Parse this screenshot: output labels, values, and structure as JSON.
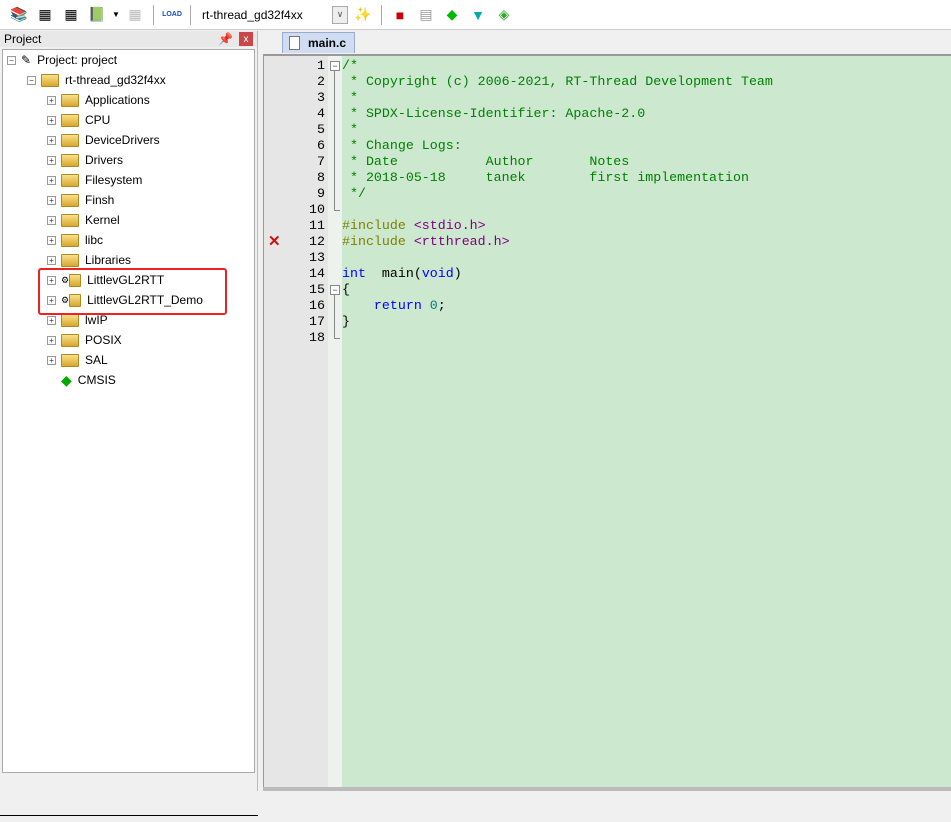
{
  "toolbar": {
    "icons": [
      "translate-icon",
      "build-icon",
      "rebuild-icon",
      "batch-build-icon",
      "stop-build-icon",
      "load-icon"
    ],
    "target": "rt-thread_gd32f4xx",
    "right_icons": [
      "options-icon",
      "manage-components-icon",
      "file-extensions-icon",
      "pack-installer-icon",
      "select-packs-icon",
      "manage-rte-icon"
    ]
  },
  "project": {
    "title": "Project",
    "pin": "⎕",
    "close": "x",
    "root": "Project: project",
    "target": "rt-thread_gd32f4xx",
    "groups": [
      "Applications",
      "CPU",
      "DeviceDrivers",
      "Drivers",
      "Filesystem",
      "Finsh",
      "Kernel",
      "libc",
      "Libraries",
      "LittlevGL2RTT",
      "LittlevGL2RTT_Demo",
      "lwIP",
      "POSIX",
      "SAL"
    ],
    "component": "CMSIS"
  },
  "editor": {
    "tab": "main.c",
    "error_line": 12,
    "lines": [
      [
        [
          "cm",
          "/*"
        ]
      ],
      [
        [
          "cm",
          " * Copyright (c) 2006-2021, RT-Thread Development Team"
        ]
      ],
      [
        [
          "cm",
          " *"
        ]
      ],
      [
        [
          "cm",
          " * SPDX-License-Identifier: Apache-2.0"
        ]
      ],
      [
        [
          "cm",
          " *"
        ]
      ],
      [
        [
          "cm",
          " * Change Logs:"
        ]
      ],
      [
        [
          "cm",
          " * Date           Author       Notes"
        ]
      ],
      [
        [
          "cm",
          " * 2018-05-18     tanek        first implementation"
        ]
      ],
      [
        [
          "cm",
          " */"
        ]
      ],
      [],
      [
        [
          "pp",
          "#include "
        ],
        [
          "str",
          "<stdio.h>"
        ]
      ],
      [
        [
          "pp",
          "#include "
        ],
        [
          "str",
          "<rtthread.h>"
        ]
      ],
      [],
      [
        [
          "kw",
          "int"
        ],
        [
          "",
          "  main("
        ],
        [
          "kw",
          "void"
        ],
        [
          "",
          ")"
        ]
      ],
      [
        [
          "",
          "{"
        ]
      ],
      [
        [
          "",
          "    "
        ],
        [
          "kw",
          "return"
        ],
        [
          "",
          " "
        ],
        [
          "num",
          "0"
        ],
        [
          "",
          ";"
        ]
      ],
      [
        [
          "",
          "}"
        ]
      ],
      []
    ]
  }
}
